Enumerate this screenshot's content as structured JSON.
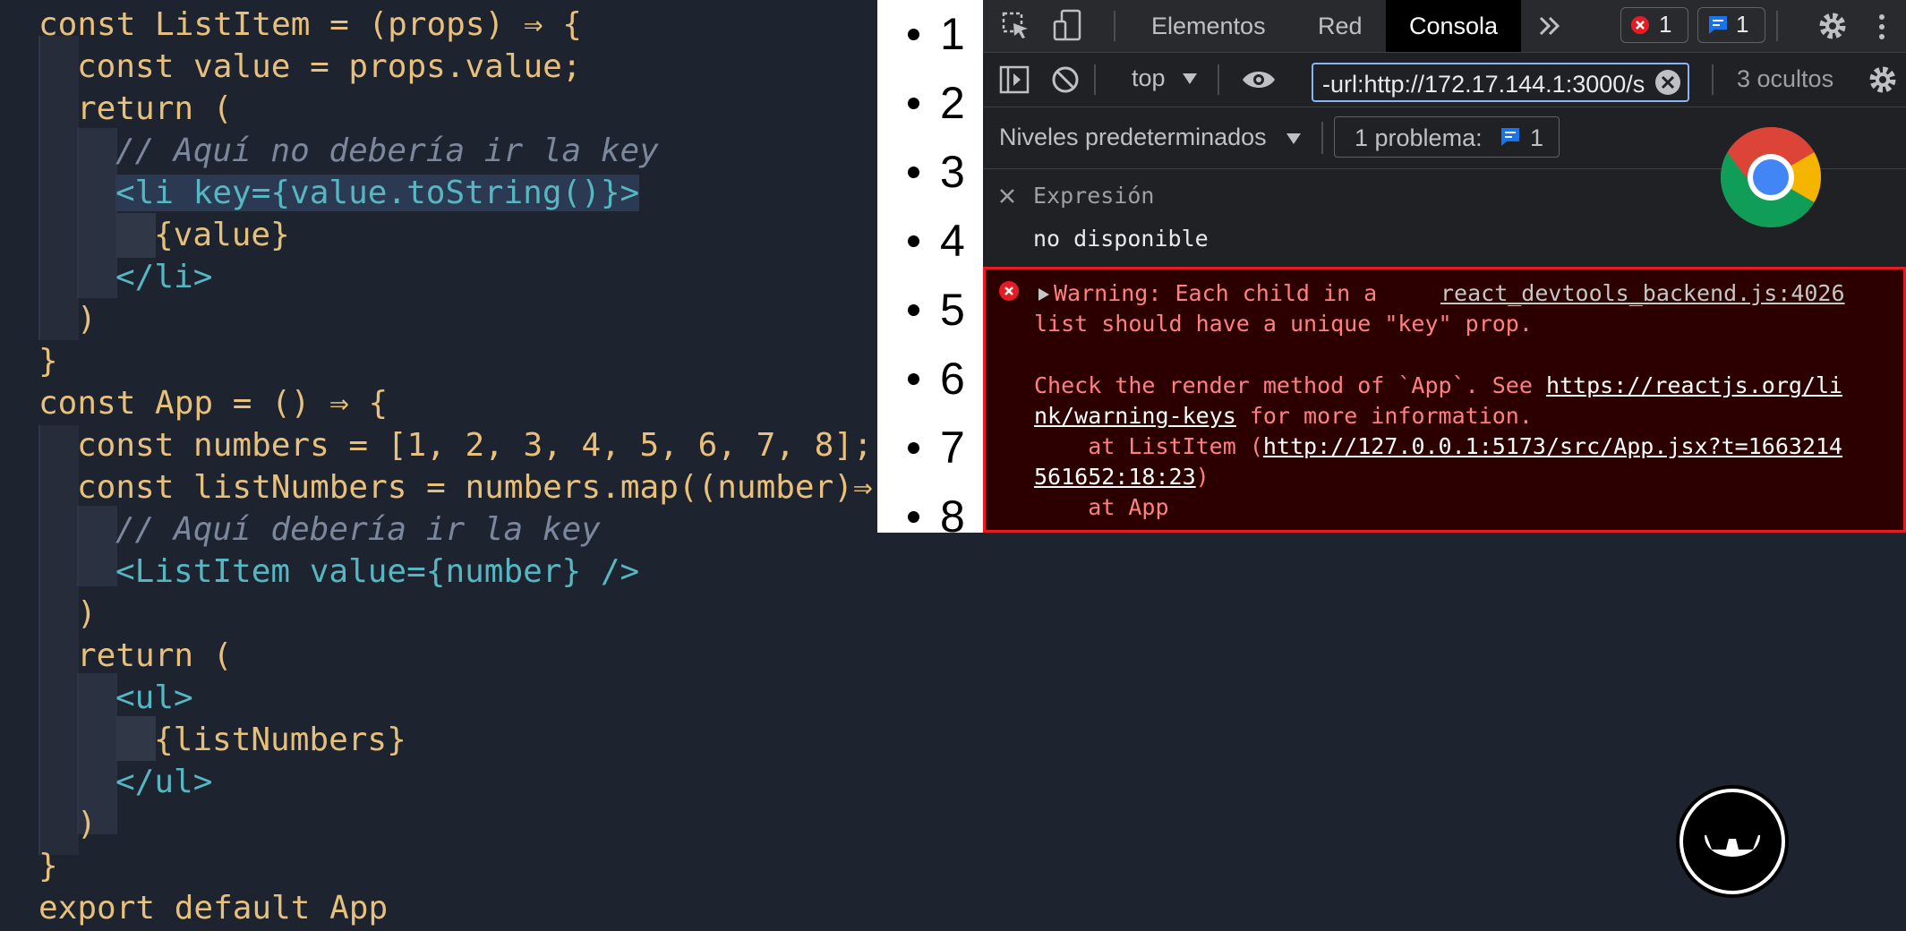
{
  "editor": {
    "lines": [
      "const ListItem = (props) ⇒ {",
      "const value = props.value;",
      "return (",
      "// Aquí no debería ir la key",
      "<li key={value.toString()}>",
      "{value}",
      "</li>",
      ")",
      "}",
      "const App = () ⇒ {",
      "const numbers = [1, 2, 3, 4, 5, 6, 7, 8];",
      "const listNumbers = numbers.map((number)⇒",
      "// Aquí debería ir la key",
      "<ListItem value={number} />",
      ")",
      "return (",
      "<ul>",
      "{listNumbers}",
      "</ul>",
      ")",
      "}",
      "export default App"
    ]
  },
  "rendered_list": [
    "1",
    "2",
    "3",
    "4",
    "5",
    "6",
    "7",
    "8"
  ],
  "devtools": {
    "tabs": [
      "Elementos",
      "Red",
      "Consola"
    ],
    "active_tab": "Consola",
    "error_count": "1",
    "message_count": "1",
    "context": "top",
    "filter_value": "-url:http://172.17.144.1:3000/s",
    "hidden_count": "3 ocultos",
    "levels": "Niveles predeterminados",
    "issues_label": "1 problema:",
    "issues_count": "1",
    "expression_label": "Expresión",
    "expression_value": "no disponible",
    "error": {
      "line1": "Warning: Each child in a",
      "source": "react_devtools_backend.js:4026",
      "line2": "list should have a unique \"key\" prop.",
      "line3a": "Check the render method of `App`. See ",
      "link1a": "https://reactjs.org/li",
      "link1b": "nk/warning-keys",
      "line4": " for more information.",
      "line5a": "    at ListItem (",
      "link2a": "http://127.0.0.1:5173/src/App.jsx?t=1663214",
      "link2b": "561652:18:23",
      "line5b": ")",
      "line6": "    at App"
    }
  }
}
